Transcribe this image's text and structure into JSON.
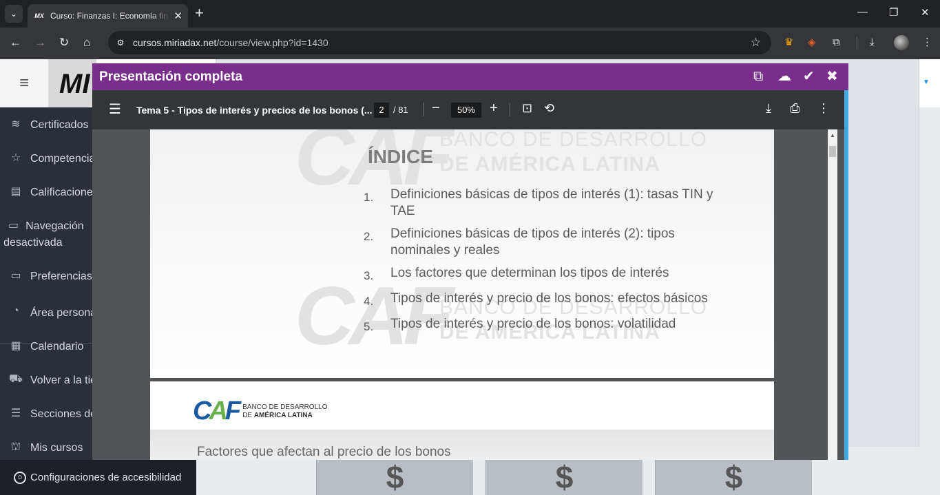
{
  "browser": {
    "tab_favicon": "MX",
    "tab_title": "Curso: Finanzas I: Economía financiera",
    "url_host": "cursos.miriadax.net",
    "url_path": "/course/view.php?id=1430",
    "icons": [
      "back-icon",
      "forward-icon",
      "reload-icon",
      "home-icon",
      "site-info-icon",
      "bookmark-star-icon",
      "crown-extension-icon",
      "hat-extension-icon",
      "extensions-puzzle-icon",
      "download-icon",
      "profile-avatar",
      "more-menu-icon"
    ]
  },
  "site": {
    "logo_text": "MI"
  },
  "sidebar": {
    "items": [
      {
        "icon": "layers-icon",
        "glyph": "≋",
        "label": "Certificados"
      },
      {
        "icon": "star-icon",
        "glyph": "☆",
        "label": "Competencias"
      },
      {
        "icon": "gradebook-icon",
        "glyph": "▤",
        "label": "Calificaciones"
      },
      {
        "icon": "folder-icon",
        "glyph": "▭",
        "label": "Navegación desactivada"
      },
      {
        "icon": "folder-icon",
        "glyph": "▭",
        "label": "Preferencias"
      },
      {
        "icon": "dashboard-icon",
        "glyph": "◔",
        "label": "Área personal"
      },
      {
        "icon": "calendar-icon",
        "glyph": "▦",
        "label": "Calendario"
      },
      {
        "icon": "cart-icon",
        "glyph": "⛟",
        "label": "Volver a la tienda"
      },
      {
        "icon": "list-icon",
        "glyph": "☰",
        "label": "Secciones del curso"
      },
      {
        "icon": "graduation-cap-icon",
        "glyph": "⛫",
        "label": "Mis cursos"
      }
    ],
    "footer_label": "Configuraciones de accesibilidad"
  },
  "content": {
    "card_icon": "$"
  },
  "modal": {
    "title": "Presentación completa",
    "header_icons": [
      "copy-icon",
      "cloud-download-icon",
      "check-circle-icon",
      "close-icon"
    ]
  },
  "pdf": {
    "doc_title": "Tema 5 - Tipos de interés y precios de los bonos (...",
    "current_page": "2",
    "total_pages": "/ 81",
    "zoom": "50%"
  },
  "slide1": {
    "heading": "ÍNDICE",
    "watermark_logo": "CAF",
    "watermark_line1": "BANCO DE DESARROLLO",
    "watermark_line2": "DE AMÉRICA LATINA",
    "items": [
      {
        "num": "1.",
        "text": "Definiciones básicas de tipos de interés (1): tasas TIN y TAE"
      },
      {
        "num": "2.",
        "text": "Definiciones básicas de tipos de interés (2): tipos nominales y reales"
      },
      {
        "num": "3.",
        "text": "Los factores que determinan los tipos de interés"
      },
      {
        "num": "4.",
        "text": "Tipos de interés y precio de los bonos: efectos básicos"
      },
      {
        "num": "5.",
        "text": "Tipos de interés y precio de los bonos: volatilidad"
      }
    ]
  },
  "slide2": {
    "logo_line1": "BANCO DE DESARROLLO",
    "logo_line2_prefix": "DE ",
    "logo_line2_bold": "AMÉRICA LATINA",
    "subtitle": "Factores que afectan al precio de los bonos"
  },
  "colors": {
    "modal_header": "#7a2e8b",
    "modal_accent": "#3fa9e0",
    "pdf_toolbar": "#323639",
    "sidebar": "#2b2f3a",
    "caf_blue": "#1a5aa0",
    "caf_green": "#6ab04c"
  }
}
